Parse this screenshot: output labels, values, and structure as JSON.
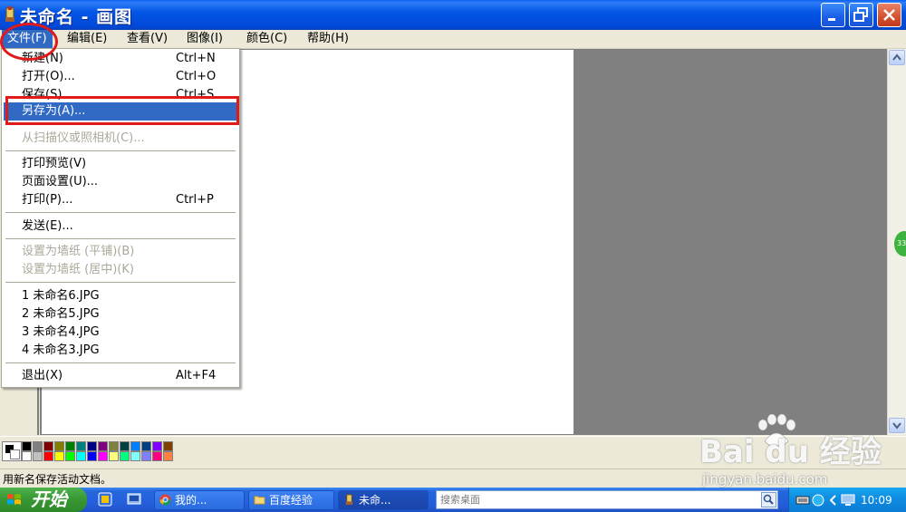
{
  "window": {
    "title": "未命名 - 画图",
    "icon": "paint-brush-icon",
    "controls": [
      "minimize",
      "maximize",
      "close"
    ]
  },
  "menubar": {
    "items": [
      {
        "label": "文件(F)",
        "active": true
      },
      {
        "label": "编辑(E)"
      },
      {
        "label": "查看(V)"
      },
      {
        "label": "图像(I)"
      },
      {
        "label": "颜色(C)"
      },
      {
        "label": "帮助(H)"
      }
    ]
  },
  "file_menu": {
    "items": [
      {
        "label": "新建(N)",
        "shortcut": "Ctrl+N"
      },
      {
        "label": "打开(O)...",
        "shortcut": "Ctrl+O"
      },
      {
        "label": "保存(S)",
        "shortcut": "Ctrl+S"
      },
      {
        "label": "另存为(A)...",
        "shortcut": "",
        "highlighted": true
      },
      {
        "label": "从扫描仪或照相机(C)...",
        "shortcut": "",
        "disabled": true
      },
      {
        "label": "打印预览(V)",
        "shortcut": ""
      },
      {
        "label": "页面设置(U)...",
        "shortcut": ""
      },
      {
        "label": "打印(P)...",
        "shortcut": "Ctrl+P"
      },
      {
        "label": "发送(E)...",
        "shortcut": ""
      },
      {
        "label": "设置为墙纸 (平铺)(B)",
        "shortcut": "",
        "disabled": true
      },
      {
        "label": "设置为墙纸 (居中)(K)",
        "shortcut": "",
        "disabled": true
      },
      {
        "label": "1 未命名6.JPG",
        "shortcut": ""
      },
      {
        "label": "2 未命名5.JPG",
        "shortcut": ""
      },
      {
        "label": "3 未命名4.JPG",
        "shortcut": ""
      },
      {
        "label": "4 未命名3.JPG",
        "shortcut": ""
      },
      {
        "label": "退出(X)",
        "shortcut": "Alt+F4"
      }
    ]
  },
  "palette": {
    "foreground": "#000000",
    "background": "#FFFFFF",
    "row1": [
      "#000000",
      "#808080",
      "#800000",
      "#808000",
      "#008000",
      "#008080",
      "#000080",
      "#800080",
      "#808040",
      "#004040",
      "#0080FF",
      "#004080",
      "#8000FF",
      "#804000"
    ],
    "row2": [
      "#FFFFFF",
      "#C0C0C0",
      "#FF0000",
      "#FFFF00",
      "#00FF00",
      "#00FFFF",
      "#0000FF",
      "#FF00FF",
      "#FFFF80",
      "#00FF80",
      "#80FFFF",
      "#8080FF",
      "#FF0080",
      "#FF8040"
    ]
  },
  "statusbar": {
    "text": "用新名保存活动文档。"
  },
  "taskbar": {
    "start_label": "开始",
    "tasks": [
      {
        "label": "我的...",
        "icon": "chrome-icon"
      },
      {
        "label": "百度经验",
        "icon": "folder-icon"
      },
      {
        "label": "未命...",
        "icon": "paint-icon",
        "active": true
      }
    ],
    "search_placeholder": "搜索桌面",
    "clock": "10:09"
  },
  "watermark": {
    "brand": "Bai du 经验",
    "url": "jingyan.baidu.com"
  }
}
